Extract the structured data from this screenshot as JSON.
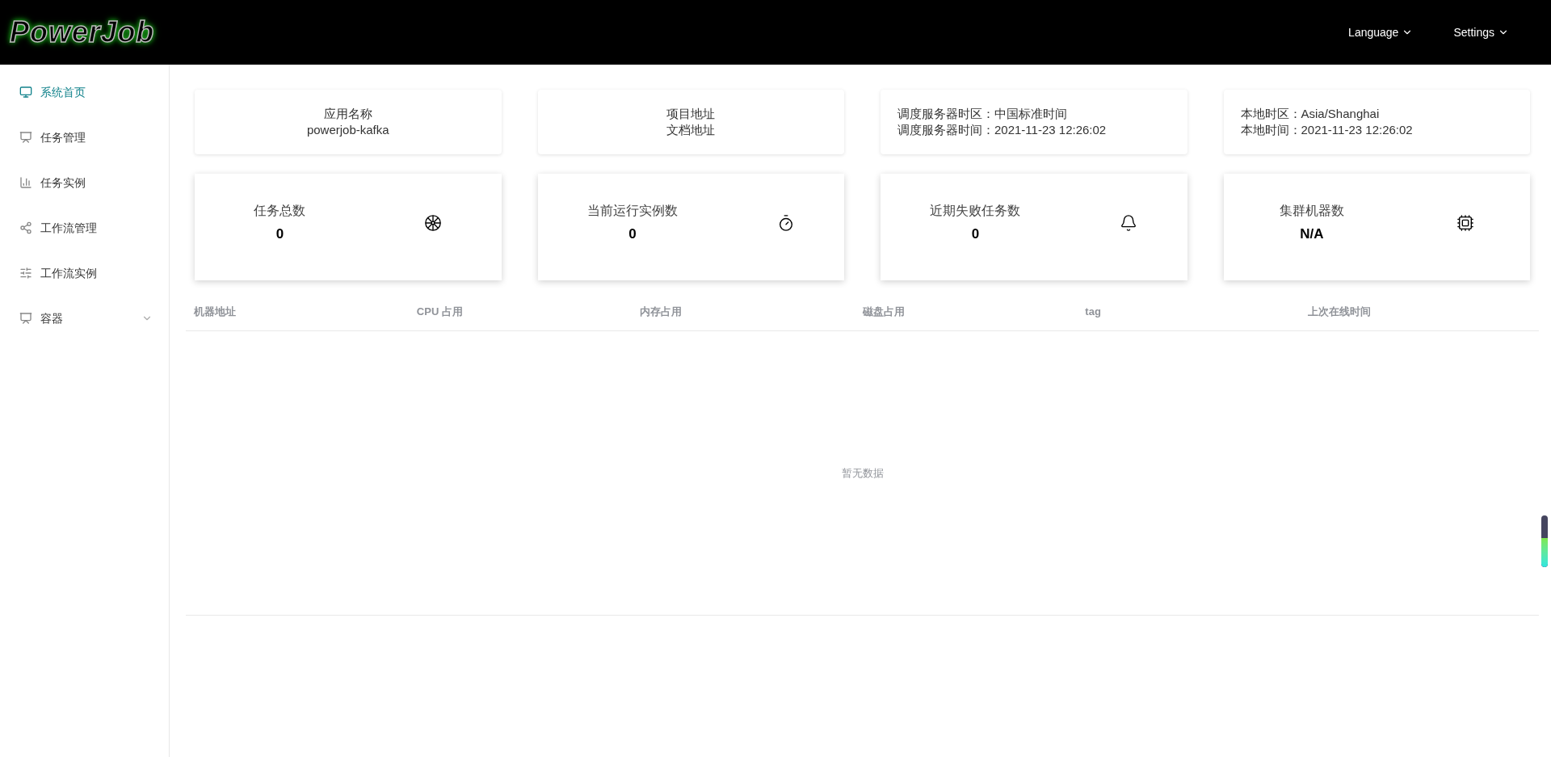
{
  "header": {
    "logo": "PowerJob",
    "menus": [
      {
        "label": "Language"
      },
      {
        "label": "Settings"
      }
    ]
  },
  "sidebar": {
    "items": [
      {
        "label": "系统首页",
        "selected": true,
        "kind": "link"
      },
      {
        "label": "任务管理",
        "selected": false,
        "kind": "link"
      },
      {
        "label": "任务实例",
        "selected": false,
        "kind": "link"
      },
      {
        "label": "工作流管理",
        "selected": false,
        "kind": "link"
      },
      {
        "label": "工作流实例",
        "selected": false,
        "kind": "link"
      },
      {
        "label": "容器",
        "selected": false,
        "kind": "group"
      }
    ]
  },
  "info_cards": [
    {
      "lines": [
        "应用名称",
        "powerjob-kafka"
      ]
    },
    {
      "lines": [
        "项目地址",
        "文档地址"
      ]
    },
    {
      "lines": [
        "调度服务器时区：中国标准时间",
        "调度服务器时间：2021-11-23 12:26:02"
      ]
    },
    {
      "lines": [
        "本地时区：Asia/Shanghai",
        "本地时间：2021-11-23 12:26:02"
      ]
    }
  ],
  "stat_cards": [
    {
      "label": "任务总数",
      "value": "0"
    },
    {
      "label": "当前运行实例数",
      "value": "0"
    },
    {
      "label": "近期失败任务数",
      "value": "0"
    },
    {
      "label": "集群机器数",
      "value": "N/A"
    }
  ],
  "table": {
    "columns": [
      "机器地址",
      "CPU 占用",
      "内存占用",
      "磁盘占用",
      "tag",
      "上次在线时间"
    ],
    "empty_text": "暂无数据"
  },
  "side_gauge": {
    "level": 0.57
  }
}
